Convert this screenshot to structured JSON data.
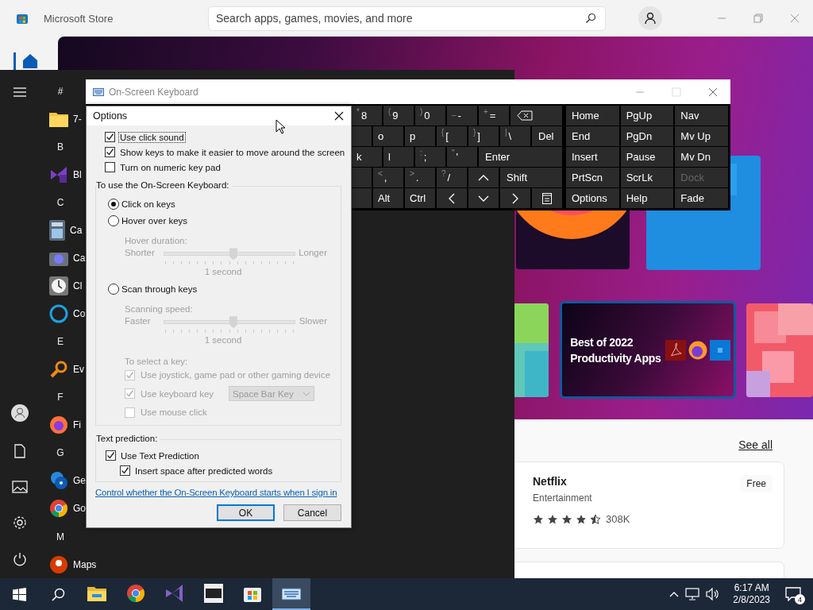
{
  "store": {
    "title": "Microsoft Store",
    "search": {
      "placeholder": "Search apps, games, movies, and more"
    },
    "feature_card": {
      "title": "Best of 2022 Productivity Apps",
      "selected": true
    },
    "see_all": "See all",
    "app_card": {
      "name": "Netflix",
      "category": "Entertainment",
      "stars": 4.5,
      "rating_count": "308K",
      "price": "Free"
    }
  },
  "start_menu": {
    "groups": [
      {
        "letter": "#",
        "apps": [
          {
            "name": "7-"
          }
        ]
      },
      {
        "letter": "B",
        "apps": [
          {
            "name": "Bl"
          }
        ]
      },
      {
        "letter": "C",
        "apps": [
          {
            "name": "Ca"
          },
          {
            "name": "Ca"
          },
          {
            "name": "Cl"
          },
          {
            "name": "Co"
          }
        ]
      },
      {
        "letter": "E",
        "apps": [
          {
            "name": "Ev"
          }
        ]
      },
      {
        "letter": "F",
        "apps": [
          {
            "name": "Fi"
          }
        ]
      },
      {
        "letter": "G",
        "apps": [
          {
            "name": "Ge"
          },
          {
            "name": "Go"
          }
        ]
      },
      {
        "letter": "M",
        "apps": [
          {
            "name": "Maps"
          }
        ]
      }
    ]
  },
  "on_screen_keyboard": {
    "title": "On-Screen Keyboard",
    "main_rows": [
      [
        {
          "kind": "char",
          "shift": "*",
          "label": "8"
        },
        {
          "kind": "char",
          "shift": "(",
          "label": "9"
        },
        {
          "kind": "char",
          "shift": ")",
          "label": "0"
        },
        {
          "kind": "char",
          "shift": "_",
          "label": "-"
        },
        {
          "kind": "char",
          "shift": "+",
          "label": "="
        },
        {
          "kind": "backspace"
        }
      ],
      [
        {
          "kind": "edge"
        },
        {
          "kind": "char",
          "label": "o"
        },
        {
          "kind": "char",
          "label": "p"
        },
        {
          "kind": "char",
          "shift": "{",
          "label": "["
        },
        {
          "kind": "char",
          "shift": "}",
          "label": "]"
        },
        {
          "kind": "char",
          "shift": "|",
          "label": "\\"
        },
        {
          "kind": "wide",
          "label": "Del"
        }
      ],
      [
        {
          "kind": "char",
          "label": "k"
        },
        {
          "kind": "char",
          "label": "l"
        },
        {
          "kind": "char",
          "shift": ":",
          "label": ";"
        },
        {
          "kind": "char",
          "shift": "\"",
          "label": "'"
        },
        {
          "kind": "wide",
          "label": "Enter"
        }
      ],
      [
        {
          "kind": "edge"
        },
        {
          "kind": "char",
          "shift": "<",
          "label": ","
        },
        {
          "kind": "char",
          "shift": ">",
          "label": "."
        },
        {
          "kind": "char",
          "shift": "?",
          "label": "/"
        },
        {
          "kind": "up"
        },
        {
          "kind": "wide",
          "label": "Shift"
        }
      ],
      [
        {
          "kind": "edge"
        },
        {
          "kind": "char",
          "label": "Alt"
        },
        {
          "kind": "char",
          "label": "Ctrl"
        },
        {
          "kind": "left"
        },
        {
          "kind": "down"
        },
        {
          "kind": "right"
        },
        {
          "kind": "menu"
        }
      ]
    ],
    "nav_rows": [
      [
        {
          "label": "Home",
          "disabled": false
        },
        {
          "label": "PgUp",
          "disabled": false
        },
        {
          "label": "Nav",
          "disabled": false
        }
      ],
      [
        {
          "label": "End",
          "disabled": false
        },
        {
          "label": "PgDn",
          "disabled": false
        },
        {
          "label": "Mv Up",
          "disabled": false
        }
      ],
      [
        {
          "label": "Insert",
          "disabled": false
        },
        {
          "label": "Pause",
          "disabled": false
        },
        {
          "label": "Mv Dn",
          "disabled": false
        }
      ],
      [
        {
          "label": "PrtScn",
          "disabled": false
        },
        {
          "label": "ScrLk",
          "disabled": false
        },
        {
          "label": "Dock",
          "disabled": true
        }
      ],
      [
        {
          "label": "Options",
          "disabled": false
        },
        {
          "label": "Help",
          "disabled": false
        },
        {
          "label": "Fade",
          "disabled": false
        }
      ]
    ]
  },
  "options_dialog": {
    "title": "Options",
    "checkboxes": [
      {
        "label": "Use click sound",
        "checked": true,
        "focused": true
      },
      {
        "label": "Show keys to make it easier to move around the screen",
        "checked": true,
        "focused": false
      },
      {
        "label": "Turn on numeric key pad",
        "checked": false,
        "focused": false
      }
    ],
    "input_group": {
      "title": "To use the On-Screen Keyboard:",
      "items": [
        {
          "kind": "radio",
          "label": "Click on keys",
          "selected": true,
          "disabled": false
        },
        {
          "kind": "radio",
          "label": "Hover over keys",
          "selected": false,
          "disabled": false
        },
        {
          "kind": "caption",
          "label": "Hover duration:",
          "disabled": true
        },
        {
          "kind": "slider",
          "min_label": "Shorter",
          "max_label": "Longer",
          "level": 0.53,
          "disabled": true
        },
        {
          "kind": "value",
          "label": "1 second",
          "disabled": true
        },
        {
          "kind": "radio",
          "label": "Scan through keys",
          "selected": false,
          "disabled": false
        },
        {
          "kind": "caption",
          "label": "Scanning speed:",
          "disabled": true
        },
        {
          "kind": "slider",
          "min_label": "Faster",
          "max_label": "Slower",
          "level": 0.53,
          "disabled": true
        },
        {
          "kind": "value",
          "label": "1 second",
          "disabled": true
        },
        {
          "kind": "caption",
          "label": "To select a key:",
          "disabled": true
        },
        {
          "kind": "check",
          "label": "Use joystick, game pad or other gaming device",
          "checked": true,
          "disabled": true
        },
        {
          "kind": "check_dropdown",
          "label": "Use keyboard key",
          "checked": true,
          "disabled": true,
          "value": "Space Bar Key"
        },
        {
          "kind": "check",
          "label": "Use mouse click",
          "checked": false,
          "disabled": true
        }
      ]
    },
    "prediction_group": {
      "title": "Text prediction:",
      "items": [
        {
          "label": "Use Text Prediction",
          "checked": true,
          "children": [
            {
              "label": "Insert space after predicted words",
              "checked": true
            }
          ]
        }
      ]
    },
    "link": "Control whether the On-Screen Keyboard starts when I sign in",
    "buttons": [
      {
        "label": "OK",
        "default": true
      },
      {
        "label": "Cancel",
        "default": false
      }
    ]
  },
  "taskbar": {
    "apps": [
      {
        "selected": false
      },
      {
        "selected": false
      },
      {
        "selected": false
      },
      {
        "selected": false
      },
      {
        "selected": false
      },
      {
        "selected": true
      }
    ],
    "time": "6:17 AM",
    "date": "2/8/2023",
    "notification_count": "4"
  }
}
